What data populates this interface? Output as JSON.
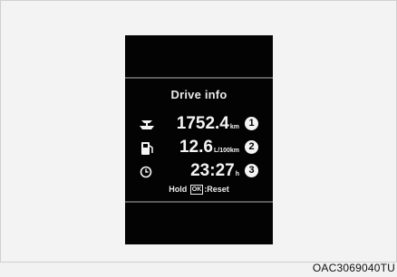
{
  "display": {
    "title": "Drive info",
    "rows": [
      {
        "icon": "distance-icon",
        "value": "1752.4",
        "unit": "km",
        "badge": "1"
      },
      {
        "icon": "fuel-pump-icon",
        "value": "12.6",
        "unit": "L/100km",
        "badge": "2"
      },
      {
        "icon": "clock-icon",
        "value": "23:27",
        "unit": "h",
        "badge": "3"
      }
    ],
    "hint": {
      "prefix": "Hold",
      "key": "OK",
      "suffix": ":Reset"
    }
  },
  "figure_code": "OAC3069040TU"
}
